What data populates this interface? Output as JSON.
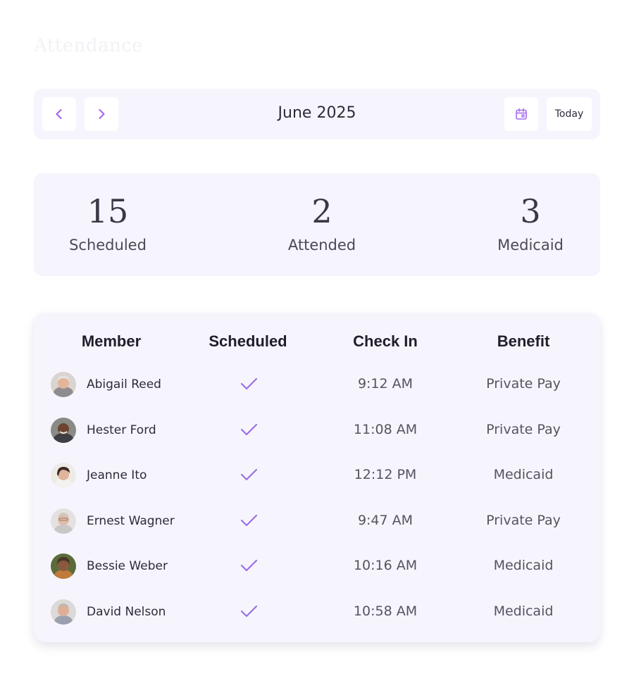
{
  "page": {
    "title": "Attendance"
  },
  "nav": {
    "prev_icon": "chevron-left-icon",
    "next_icon": "chevron-right-icon",
    "month_label": "June 2025",
    "calendar_icon": "calendar-icon",
    "today_label": "Today",
    "accent_color": "#9b5de5"
  },
  "stats": [
    {
      "value": "15",
      "label": "Scheduled"
    },
    {
      "value": "2",
      "label": "Attended"
    },
    {
      "value": "3",
      "label": "Medicaid"
    }
  ],
  "table": {
    "headers": {
      "member": "Member",
      "scheduled": "Scheduled",
      "check_in": "Check In",
      "benefit": "Benefit"
    },
    "rows": [
      {
        "member": "Abigail Reed",
        "scheduled": true,
        "check_in": "9:12 AM",
        "benefit": "Private Pay"
      },
      {
        "member": "Hester Ford",
        "scheduled": true,
        "check_in": "11:08 AM",
        "benefit": "Private Pay"
      },
      {
        "member": "Jeanne Ito",
        "scheduled": true,
        "check_in": "12:12 PM",
        "benefit": "Medicaid"
      },
      {
        "member": "Ernest Wagner",
        "scheduled": true,
        "check_in": "9:47 AM",
        "benefit": "Private Pay"
      },
      {
        "member": "Bessie Weber",
        "scheduled": true,
        "check_in": "10:16 AM",
        "benefit": "Medicaid"
      },
      {
        "member": "David Nelson",
        "scheduled": true,
        "check_in": "10:58 AM",
        "benefit": "Medicaid"
      }
    ]
  }
}
